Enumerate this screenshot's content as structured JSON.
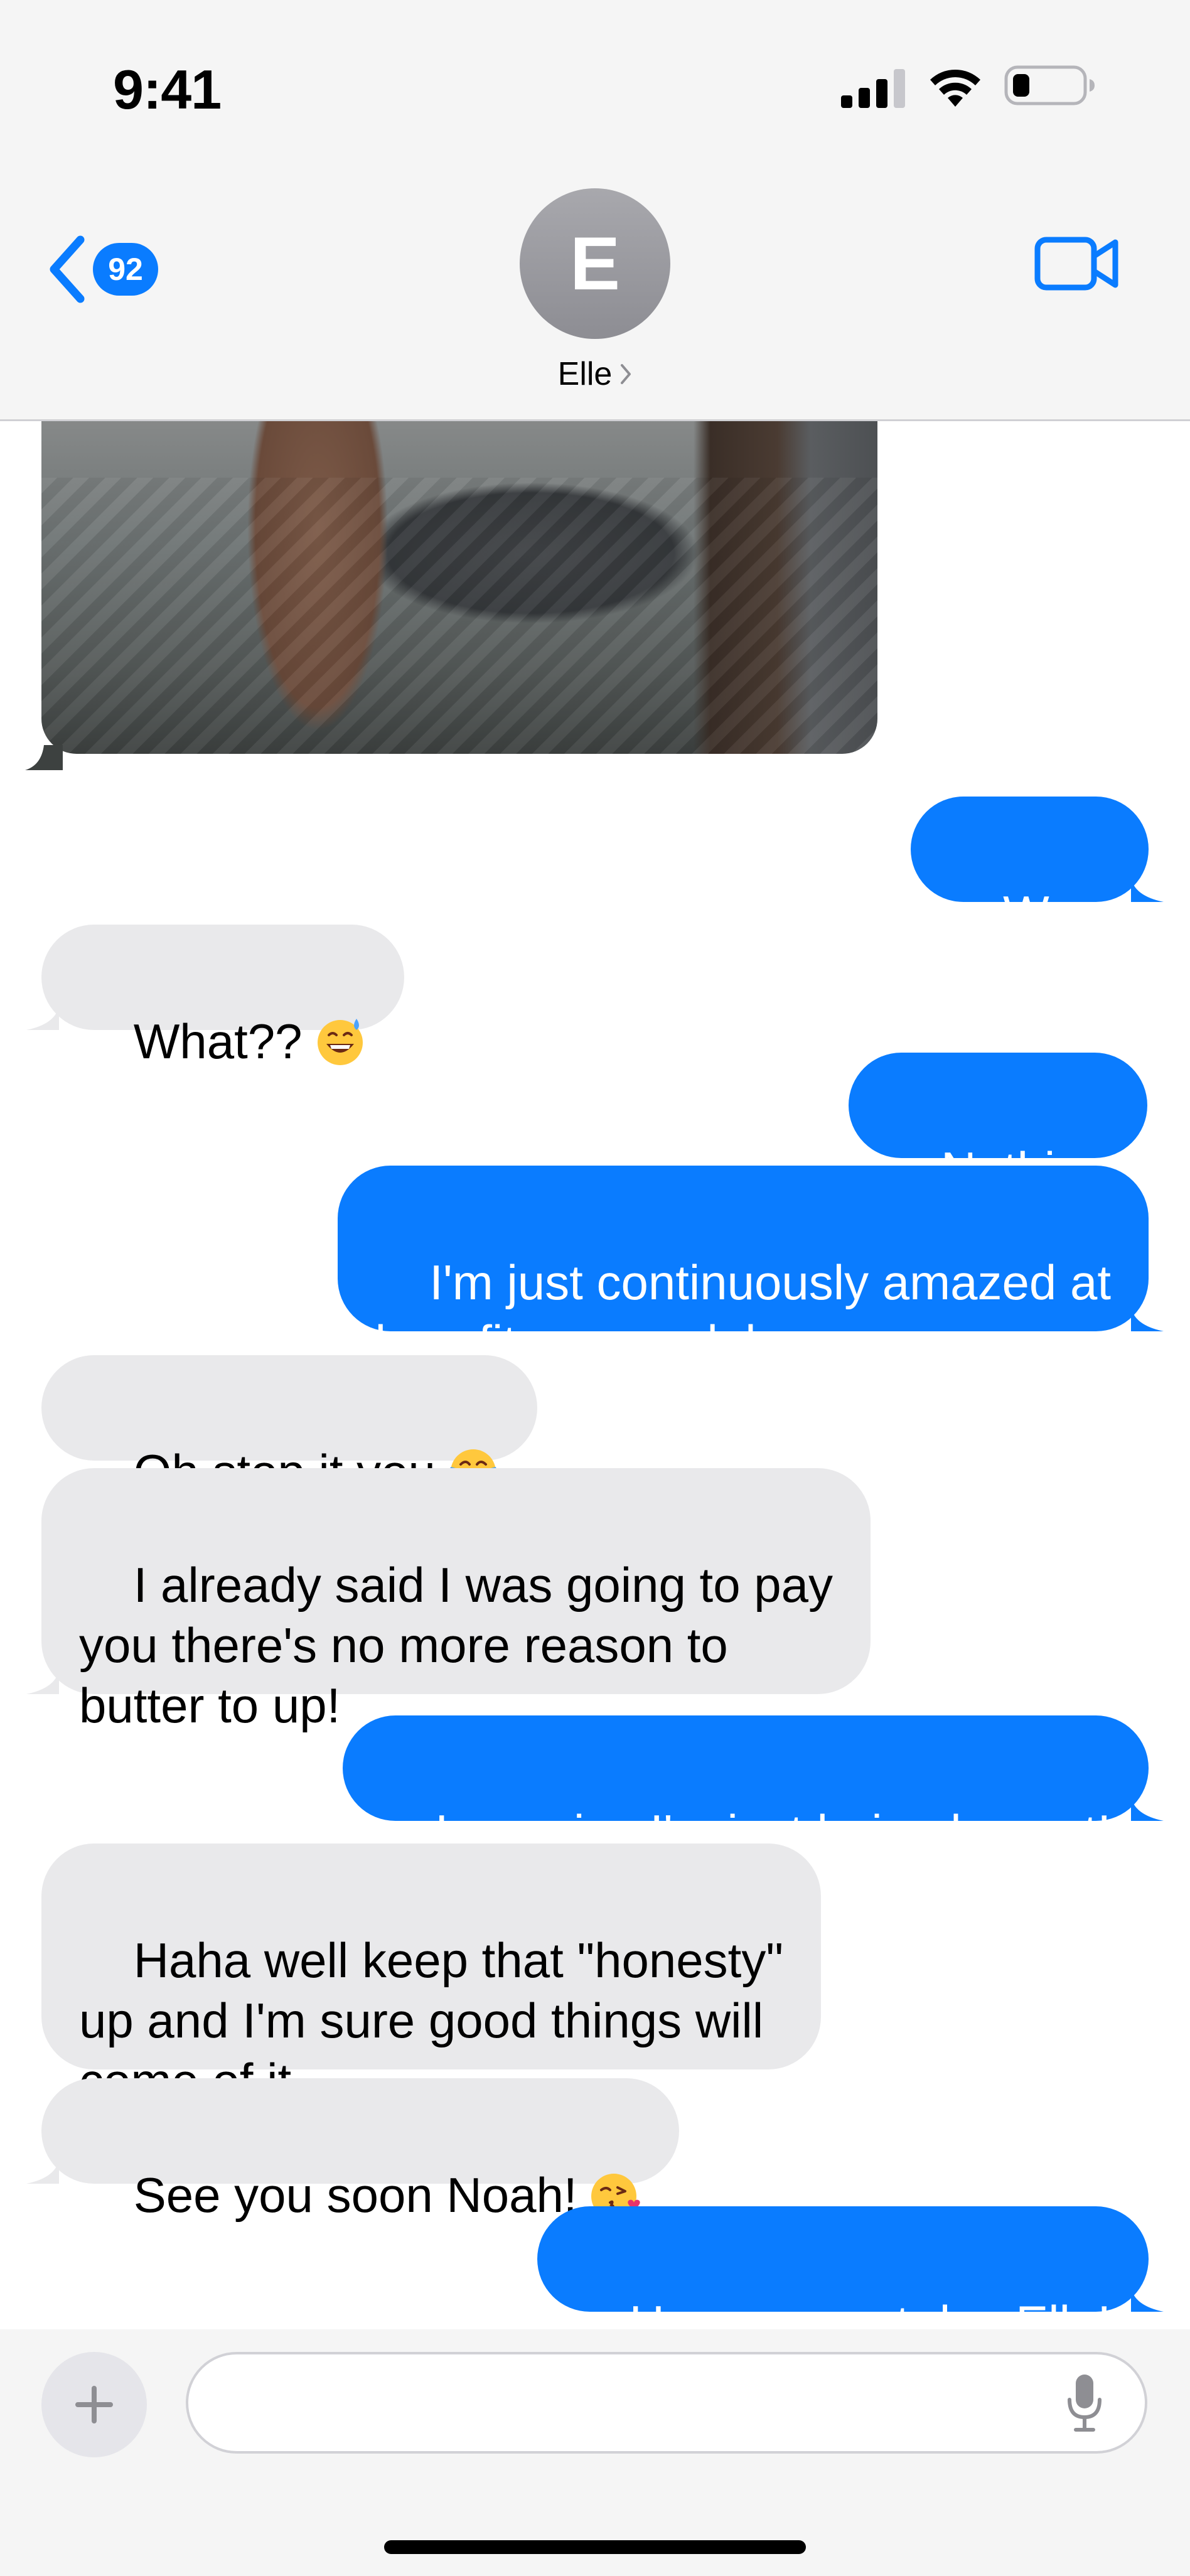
{
  "status_bar": {
    "time": "9:41"
  },
  "header": {
    "back_badge": "92",
    "avatar_initial": "E",
    "contact_name": "Elle"
  },
  "messages": [
    {
      "side": "sent",
      "text": "Wow"
    },
    {
      "side": "received",
      "text": "What??",
      "emoji": "grinning-sweat"
    },
    {
      "side": "sent",
      "text": "Nothing"
    },
    {
      "side": "sent",
      "text": "I'm just continuously amazed at\nhow fit you are lol"
    },
    {
      "side": "received",
      "text": "Oh stop it you",
      "emoji": "tears-of-joy"
    },
    {
      "side": "received",
      "text": "I already said I was going to pay\nyou there's no more reason to\nbutter to up!"
    },
    {
      "side": "sent",
      "text": "I promise I'm just being honest!"
    },
    {
      "side": "received",
      "text": "Haha well keep that \"honesty\"\nup and I'm sure good things will\ncome of it"
    },
    {
      "side": "received",
      "text": "See you soon Noah!",
      "emoji": "face-blowing-kiss"
    },
    {
      "side": "sent",
      "text": "Have a great day Elle!"
    }
  ],
  "input_bar": {
    "value": "",
    "placeholder": ""
  },
  "colors": {
    "sent_bubble": "#0a7cff",
    "received_bubble": "#e9e9eb",
    "accent": "#0a7cff"
  }
}
